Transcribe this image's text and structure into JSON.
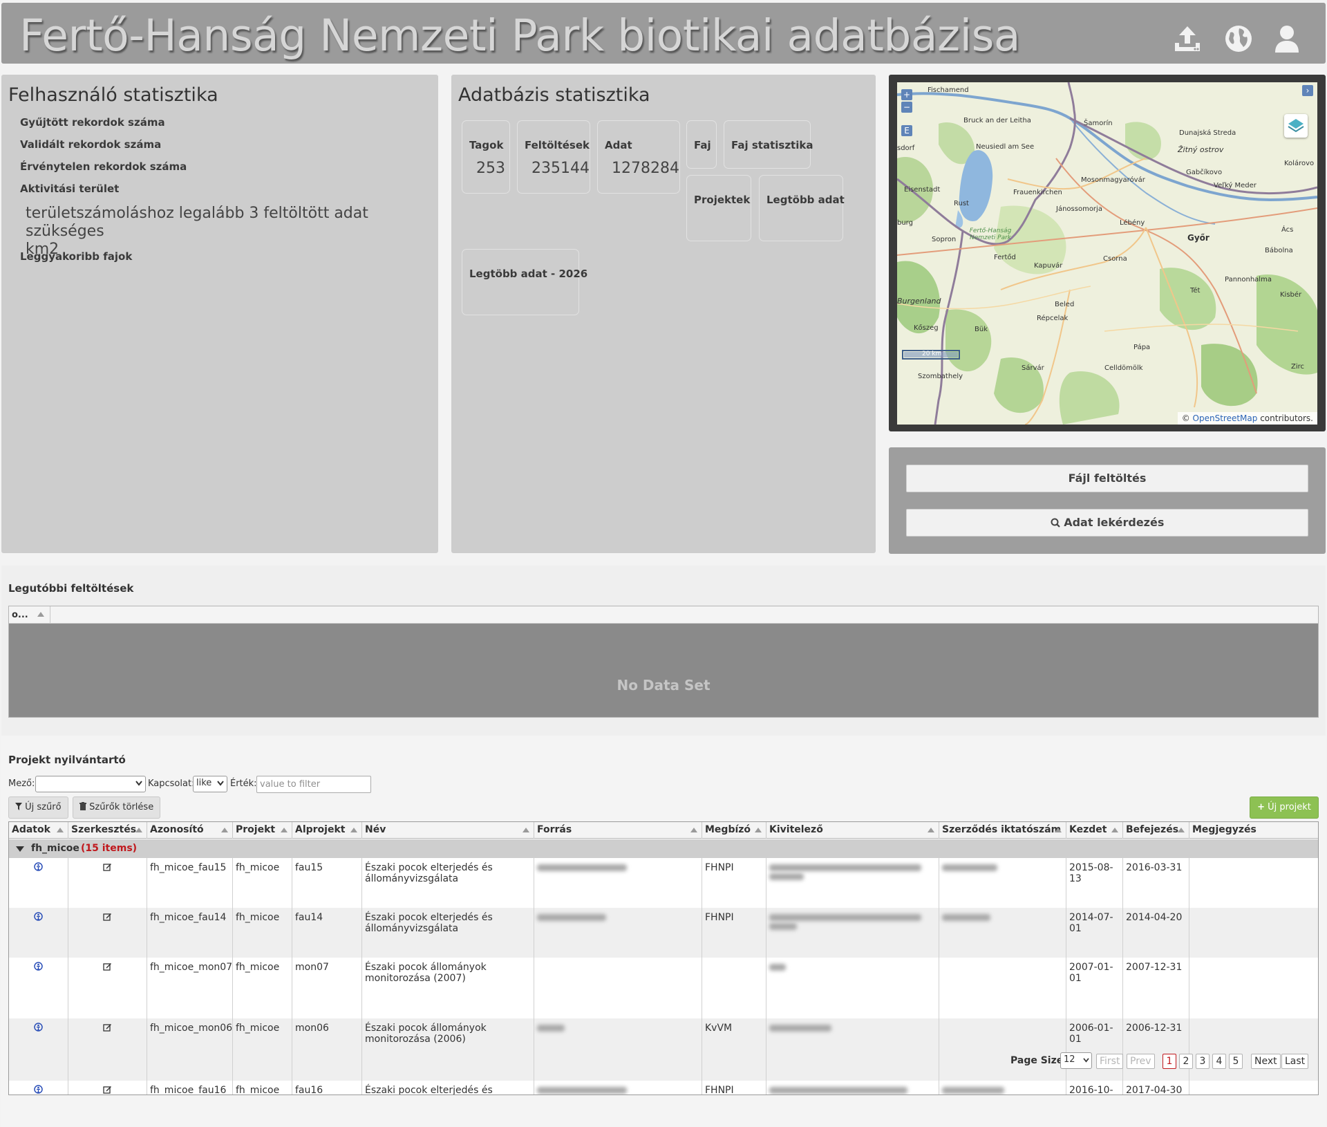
{
  "header": {
    "title": "Fertő-Hanság Nemzeti Park biotikai adatbázisa",
    "icons": [
      "upload-icon",
      "globe-icon",
      "user-icon"
    ]
  },
  "user_stats": {
    "title": "Felhasználó statisztika",
    "collected_records": "Gyűjtött rekordok száma",
    "validated_records": "Validált rekordok száma",
    "invalid_records": "Érvénytelen rekordok száma",
    "activity_area": "Aktivitási terület",
    "activity_note_line1": "területszámoláshoz legalább 3 feltöltött adat szükséges",
    "activity_note_line2": "km2",
    "frequent_species": "Leggyakoribb fajok"
  },
  "db_stats": {
    "title": "Adatbázis statisztika",
    "members_label": "Tagok",
    "members_value": "253",
    "uploads_label": "Feltöltések",
    "uploads_value": "235144",
    "data_label": "Adat",
    "data_value": "1278284",
    "species_label": "Faj",
    "species_stats_label": "Faj statisztika",
    "projects_label": "Projektek",
    "most_data_label": "Legtöbb adat",
    "most_data_year_label": "Legtöbb adat - 2026"
  },
  "map": {
    "zoom_in": "+",
    "zoom_out": "−",
    "edit_btn": "E",
    "expand_btn": "›",
    "attribution_prefix": "©",
    "attribution_link": "OpenStreetMap",
    "attribution_suffix": "contributors.",
    "scale_label": "20 km",
    "places": {
      "p1": "Fischamend",
      "p2": "Bruck an der Leitha",
      "p3": "Šamorín",
      "p4": "Dunajská Streda",
      "p5": "Žitný ostrov",
      "p6": "Kolárovo",
      "p7": "Neusiedl am See",
      "p8": "Gabčíkovo",
      "p9": "Eisenstadt",
      "p10": "Frauenkirchen",
      "p11": "Mosonmagyaróvár",
      "p12": "Veľký Meder",
      "p13": "Rust",
      "p14": "Jánossomorja",
      "p15": "Lébény",
      "p16": "Sopron",
      "p17": "Fertő-Hanság Nemzeti Park",
      "p18": "Győr",
      "p19": "Ács",
      "p20": "Fertőd",
      "p21": "Kapuvár",
      "p22": "Csorna",
      "p23": "Bábolna",
      "p24": "Pannonhalma",
      "p25": "Tét",
      "p26": "Kisbér",
      "p27": "Burgenland",
      "p28": "Beled",
      "p29": "Répcelak",
      "p30": "Kőszeg",
      "p31": "Bük",
      "p32": "Pápa",
      "p33": "Sárvár",
      "p34": "Celldömölk",
      "p35": "Zirc",
      "p36": "Szombathely",
      "p37": "sdorf",
      "p38": "burg"
    }
  },
  "actions": {
    "file_upload": "Fájl feltöltés",
    "data_query": "Adat lekérdezés"
  },
  "recent_uploads": {
    "title": "Legutóbbi feltöltések",
    "column": "o...",
    "empty": "No Data Set"
  },
  "projects": {
    "title": "Projekt nyilvántartó",
    "field_label": "Mező:",
    "field_value": "",
    "relation_label": "Kapcsolat:",
    "relation_value": "like",
    "value_label": "Érték:",
    "value_placeholder": "value to filter",
    "new_filter": "Új szűrő",
    "clear_filters": "Szűrők törlése",
    "new_project": "Új projekt",
    "columns": [
      "Adatok",
      "Szerkesztés",
      "Azonosító",
      "Projekt",
      "Alprojekt",
      "Név",
      "Forrás",
      "Megbízó",
      "Kivitelező",
      "Szerződés iktatószám",
      "Kezdet",
      "Befejezés",
      "Megjegyzés"
    ],
    "group": {
      "name": "fh_micoe",
      "count": "(15 items)"
    },
    "rows": [
      {
        "id": "fh_micoe_fau15",
        "project": "fh_micoe",
        "subproject": "fau15",
        "name": "Északi pocok elterjedés és állományvizsgálata",
        "client": "FHNPI",
        "start": "2015-08-13",
        "end": "2016-03-31"
      },
      {
        "id": "fh_micoe_fau14",
        "project": "fh_micoe",
        "subproject": "fau14",
        "name": "Északi pocok elterjedés és állományvizsgálata",
        "client": "FHNPI",
        "start": "2014-07-01",
        "end": "2014-04-20"
      },
      {
        "id": "fh_micoe_mon07",
        "project": "fh_micoe",
        "subproject": "mon07",
        "name": "Északi pocok állományok monitorozása (2007)",
        "client": "",
        "start": "2007-01-01",
        "end": "2007-12-31"
      },
      {
        "id": "fh_micoe_mon06",
        "project": "fh_micoe",
        "subproject": "mon06",
        "name": "Északi pocok állományok monitorozása (2006)",
        "client": "KvVM",
        "start": "2006-01-01",
        "end": "2006-12-31"
      },
      {
        "id": "fh_micoe_fau16",
        "project": "fh_micoe",
        "subproject": "fau16",
        "name": "Északi pocok elterjedés és",
        "client": "FHNPI",
        "start": "2016-10-20",
        "end": "2017-04-30"
      }
    ]
  },
  "pager": {
    "page_size_label": "Page Size",
    "page_size": "12",
    "first": "First",
    "prev": "Prev",
    "pages": [
      "1",
      "2",
      "3",
      "4",
      "5"
    ],
    "next": "Next",
    "last": "Last"
  }
}
